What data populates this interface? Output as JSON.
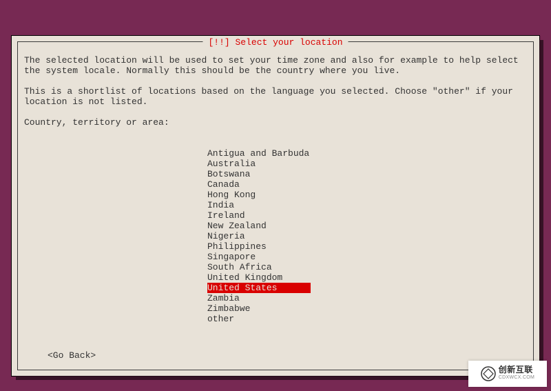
{
  "dialog": {
    "title": "[!!] Select your location",
    "paragraph1": "The selected location will be used to set your time zone and also for example to help select the system locale. Normally this should be the country where you live.",
    "paragraph2": "This is a shortlist of locations based on the language you selected. Choose \"other\" if your location is not listed.",
    "prompt": "Country, territory or area:",
    "go_back": "<Go Back>",
    "selected_index": 13,
    "locations": [
      "Antigua and Barbuda",
      "Australia",
      "Botswana",
      "Canada",
      "Hong Kong",
      "India",
      "Ireland",
      "New Zealand",
      "Nigeria",
      "Philippines",
      "Singapore",
      "South Africa",
      "United Kingdom",
      "United States",
      "Zambia",
      "Zimbabwe",
      "other"
    ]
  },
  "watermark": {
    "cn": "创新互联",
    "en": "CDXWCX.COM"
  }
}
